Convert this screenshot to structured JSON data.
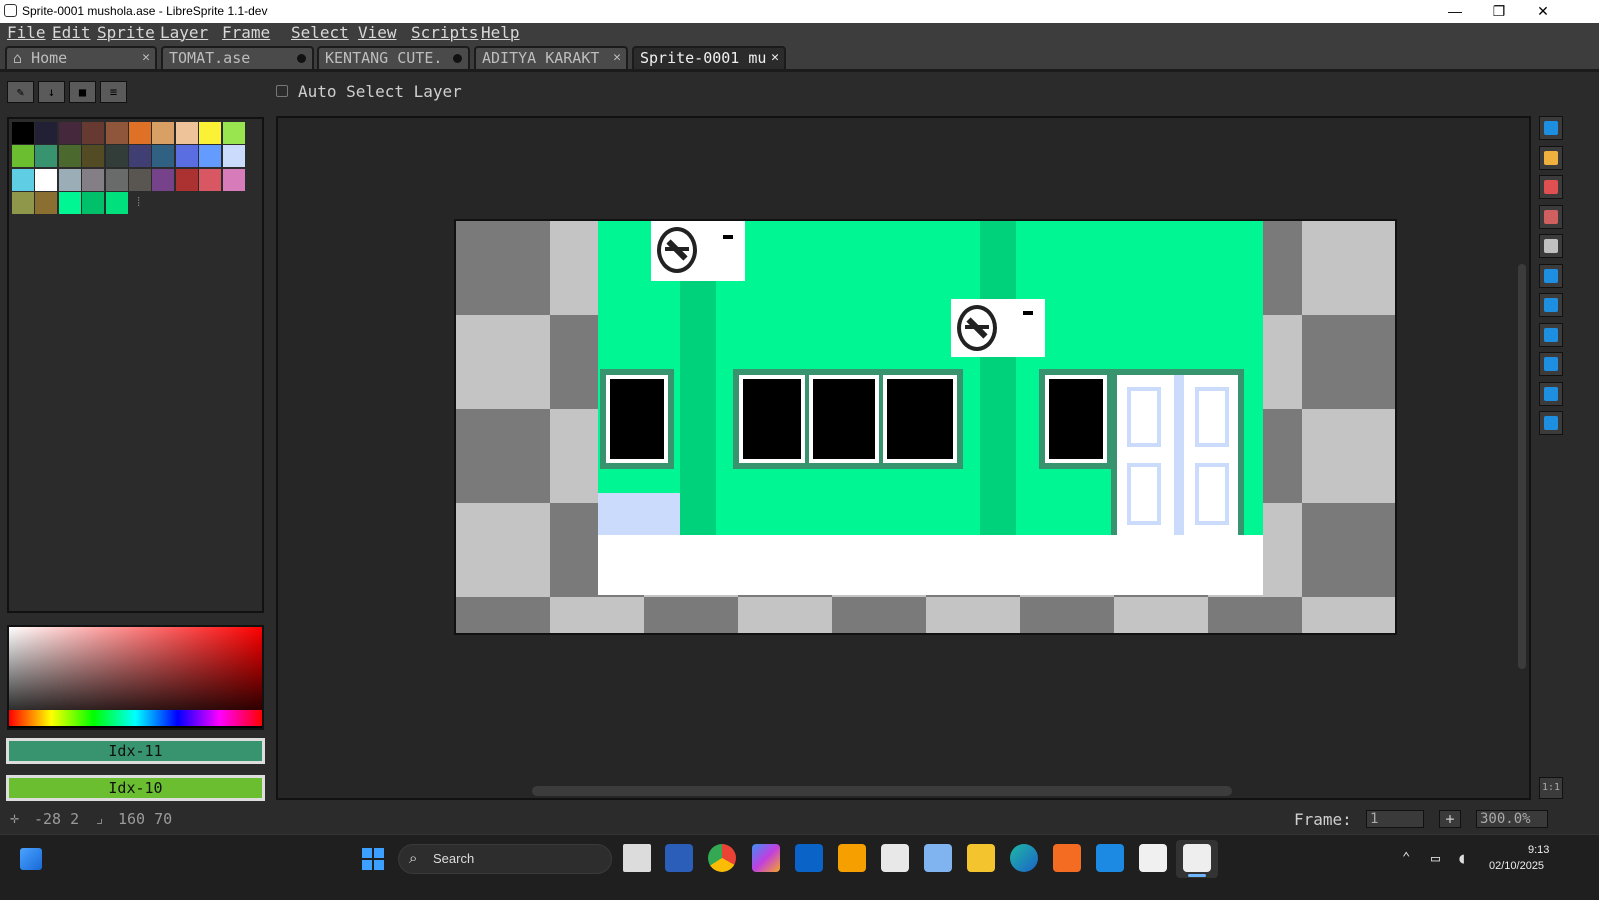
{
  "window": {
    "title": "Sprite-0001 mushola.ase - LibreSprite 1.1-dev",
    "minimize_glyph": "—",
    "maximize_glyph": "❐",
    "close_glyph": "✕"
  },
  "menu": [
    "File",
    "Edit",
    "Sprite",
    "Layer",
    "Frame",
    "Select",
    "View",
    "Scripts",
    "Help"
  ],
  "tabs": [
    {
      "label": "Home",
      "icon": "home-icon",
      "closer": "✕"
    },
    {
      "label": "TOMAT.ase",
      "closer": "modified-dot"
    },
    {
      "label": "KENTANG CUTE.",
      "closer": "modified-dot"
    },
    {
      "label": "ADITYA KARAKT",
      "closer": "✕"
    },
    {
      "label": "Sprite-0001 mu",
      "closer": "✕",
      "active": true
    }
  ],
  "toolbar_options": {
    "auto_select_layer_label": "Auto Select Layer",
    "auto_select_layer_checked": false
  },
  "palette_buttons": [
    {
      "name": "edit-palette-icon",
      "glyph": "✎"
    },
    {
      "name": "download-icon",
      "glyph": "↓"
    },
    {
      "name": "square-icon",
      "glyph": "■"
    },
    {
      "name": "menu-icon",
      "glyph": "≡"
    }
  ],
  "palette": {
    "colors": [
      "#000000",
      "#222034",
      "#45283c",
      "#663931",
      "#8f563b",
      "#df7126",
      "#d9a066",
      "#eec39a",
      "#fbf236",
      "#99e550",
      "#6abe30",
      "#37946e",
      "#4b692f",
      "#524b24",
      "#323c39",
      "#3f3f74",
      "#306082",
      "#5b6ee1",
      "#639bff",
      "#cbdbfc",
      "#5fcde4",
      "#ffffff",
      "#9badb7",
      "#847e87",
      "#696a6a",
      "#595652",
      "#76428a",
      "#ac3232",
      "#d95763",
      "#d77bba",
      "#8f974a",
      "#8a6f30",
      "#00f692",
      "#00c06a",
      "#00e07c"
    ],
    "handle": "⁞"
  },
  "colors": {
    "foreground_label": "Idx-11",
    "foreground_color": "#37946e",
    "background_label": "Idx-10",
    "background_color": "#6abe30"
  },
  "status": {
    "cursor_position": "-28 2",
    "sprite_size": "160 70",
    "frame_label": "Frame:",
    "frame_value": "1",
    "zoom": "300.0%",
    "zoom_one_to_one": "1:1"
  },
  "tools": [
    "marquee-icon",
    "pencil-icon",
    "eraser-icon",
    "eyedropper-icon",
    "zoom-icon",
    "move-icon",
    "paint-bucket-icon",
    "line-icon",
    "rectangle-icon",
    "contour-icon",
    "blur-icon"
  ],
  "taskbar": {
    "search_placeholder": "Search",
    "time": "9:13",
    "date": "02/10/2025"
  }
}
